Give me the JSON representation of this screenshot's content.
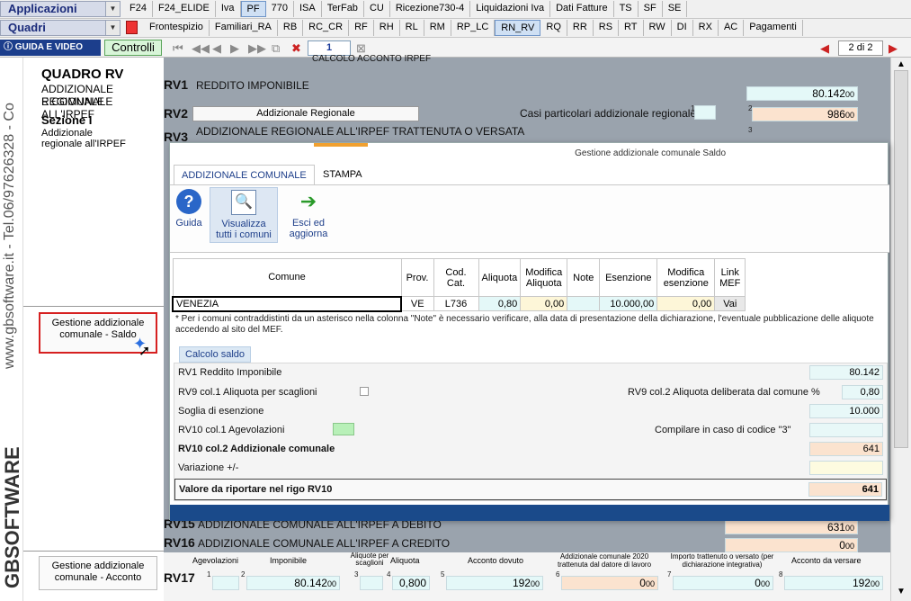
{
  "menu": {
    "app_label": "Applicazioni",
    "quadri_label": "Quadri",
    "row1_tabs": [
      "F24",
      "F24_ELIDE",
      "Iva",
      "PF",
      "770",
      "ISA",
      "TerFab",
      "CU",
      "Ricezione730-4",
      "Liquidazioni Iva",
      "Dati Fatture",
      "TS",
      "SF",
      "SE"
    ],
    "row1_active": "PF",
    "row2_tabs": [
      "Frontespizio",
      "Familiari_RA",
      "RB",
      "RC_CR",
      "RF",
      "RH",
      "RL",
      "RM",
      "RP_LC",
      "RN_RV",
      "RQ",
      "RR",
      "RS",
      "RT",
      "RW",
      "DI",
      "RX",
      "AC",
      "Pagamenti"
    ],
    "row2_active": "RN_RV"
  },
  "toolbar": {
    "guida_video": "GUIDA E VIDEO",
    "controlli": "Controlli",
    "page_input": "1",
    "page_of": "2 di 2"
  },
  "brand": {
    "website": "www.gbsoftware.it - Tel.06/97626328 - Co",
    "logo": "GBSOFTWARE"
  },
  "left": {
    "quadro": "QUADRO RV",
    "sub1": "ADDIZIONALE REGIONALE",
    "sub2": "E COMUNALE ALL'IRPEF",
    "sezione": "Sezione I",
    "sez_desc1": "Addizionale",
    "sez_desc2": "regionale all'IRPEF",
    "btn_saldo1": "Gestione addizionale",
    "btn_saldo2": "comunale - Saldo",
    "btn_acconto1": "Gestione addizionale",
    "btn_acconto2": "comunale - Acconto"
  },
  "form": {
    "top_text": "CALCOLO ACCONTO IRPEF",
    "rv1_code": "RV1",
    "rv1_label": "REDDITO IMPONIBILE",
    "rv1_value": "80.142",
    "rv2_code": "RV2",
    "rv2_btn": "Addizionale Regionale",
    "rv2_casi": "Casi particolari addizionale regionale",
    "rv2_value": "986",
    "rv3_code": "RV3",
    "rv3_label": "ADDIZIONALE REGIONALE ALL'IRPEF TRATTENUTA O VERSATA",
    "rv15_code": "RV15",
    "rv15_label": "ADDIZIONALE COMUNALE ALL'IRPEF A DEBITO",
    "rv15_value": "631",
    "rv16_code": "RV16",
    "rv16_label": "ADDIZIONALE COMUNALE ALL'IRPEF A CREDITO",
    "rv16_value": "0",
    "rv17_code": "RV17",
    "rv17_h1": "Agevolazioni",
    "rv17_h2": "Imponibile",
    "rv17_h3": "Aliquote per scaglioni",
    "rv17_h4": "Aliquota",
    "rv17_h5": "Acconto dovuto",
    "rv17_h6": "Addizionale comunale 2020 trattenuta dal datore di lavoro",
    "rv17_h7": "Importo trattenuto o versato (per dichiarazione integrativa)",
    "rv17_h8": "Acconto da versare",
    "rv17_imponibile": "80.142",
    "rv17_aliquota": "0,800",
    "rv17_acconto": "192",
    "rv17_add": "0",
    "rv17_imp": "0",
    "rv17_versare": "192",
    "cents": "00"
  },
  "dialog": {
    "title": "Gestione addizionale comunale Saldo",
    "tab_add": "ADDIZIONALE COMUNALE",
    "tab_stampa": "STAMPA",
    "btn_guida": "Guida",
    "btn_visualizza1": "Visualizza",
    "btn_visualizza2": "tutti i comuni",
    "btn_esci1": "Esci ed",
    "btn_esci2": "aggiorna",
    "table": {
      "headers": [
        "Comune",
        "Prov.",
        "Cod. Cat.",
        "Aliquota",
        "Modifica Aliquota",
        "Note",
        "Esenzione",
        "Modifica esenzione",
        "Link MEF"
      ],
      "row": {
        "comune": "VENEZIA",
        "prov": "VE",
        "cod": "L736",
        "aliquota": "0,80",
        "mod_aliquota": "0,00",
        "note": "",
        "esenzione": "10.000,00",
        "mod_esenzione": "0,00",
        "link": "Vai"
      }
    },
    "note": "* Per i comuni contraddistinti da un asterisco nella colonna \"Note\" è necessario verificare,  alla data di presentazione della dichiarazione, l'eventuale pubblicazione delle aliquote accedendo al sito del MEF.",
    "calc_tab": "Calcolo saldo",
    "calc": {
      "rv1_label": "RV1 Reddito Imponibile",
      "rv1_value": "80.142",
      "rv9c1_label": "RV9 col.1 Aliquota per scaglioni",
      "rv9c2_label": "RV9 col.2 Aliquota deliberata dal comune %",
      "rv9c2_value": "0,80",
      "soglia_label": "Soglia di esenzione",
      "soglia_value": "10.000",
      "rv10c1_label": "RV10 col.1 Agevolazioni",
      "compilare_label": "Compilare in caso di codice \"3\"",
      "rv10c2_label": "RV10 col.2 Addizionale comunale",
      "rv10c2_value": "641",
      "variazione_label": "Variazione +/-",
      "valore_label": "Valore da riportare nel rigo RV10",
      "valore_value": "641"
    }
  },
  "colors": {
    "accent": "#1c3e8c",
    "peach": "#fbe3cf",
    "cyan": "#e4f8f8",
    "form_bg": "#9aa3ad"
  }
}
